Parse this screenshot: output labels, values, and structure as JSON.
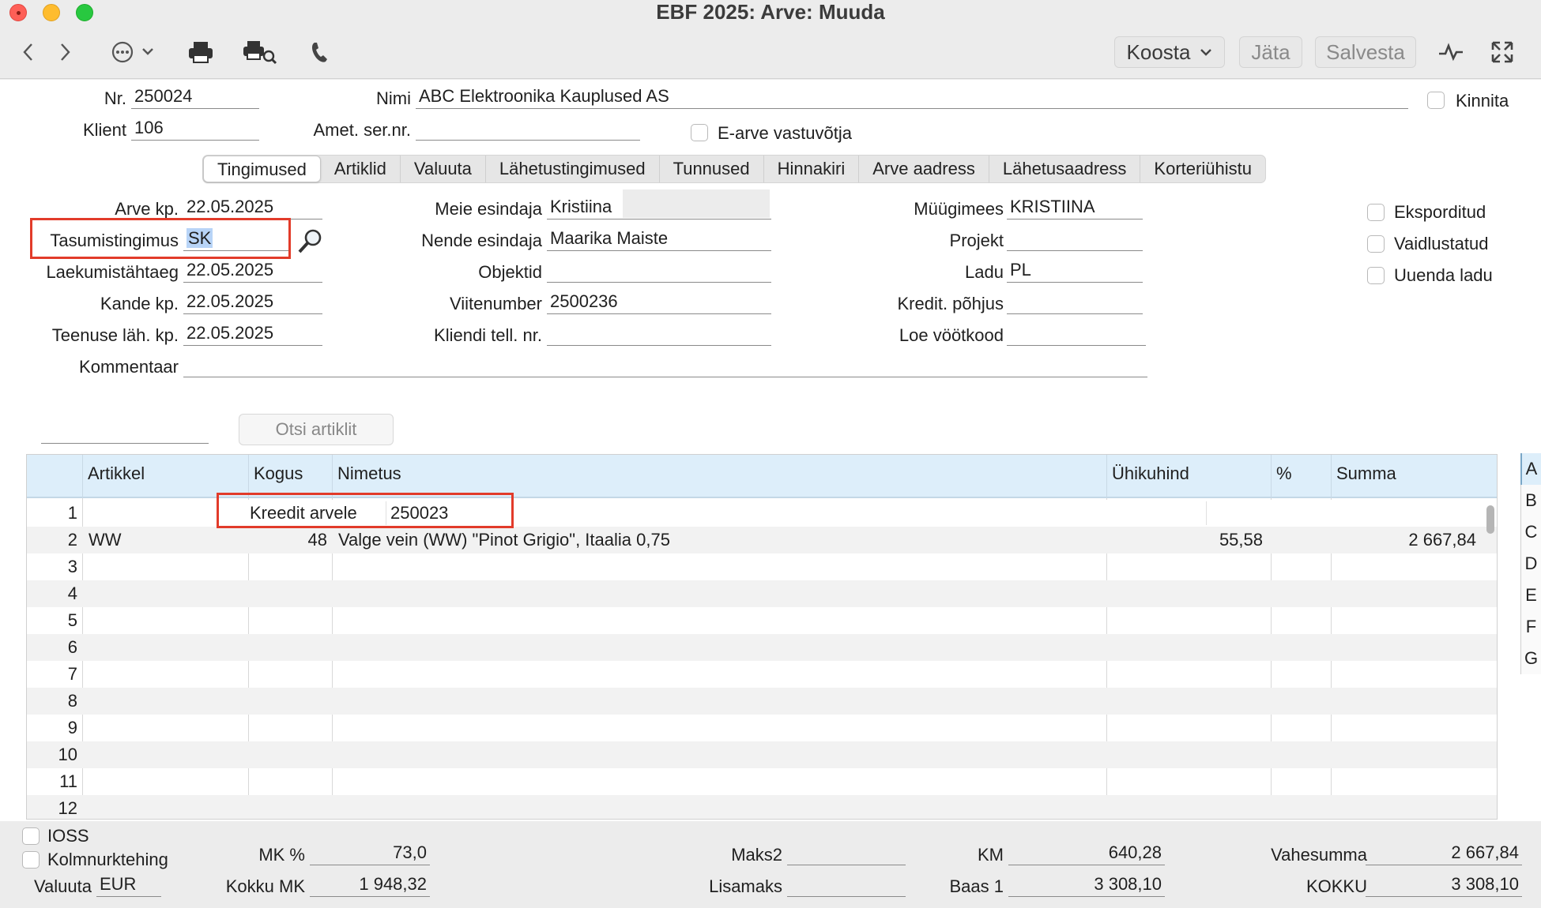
{
  "window": {
    "title": "EBF 2025: Arve: Muuda"
  },
  "toolbar": {
    "koosta_label": "Koosta",
    "jata_label": "Jäta",
    "salvesta_label": "Salvesta"
  },
  "header": {
    "nr_label": "Nr.",
    "nr_value": "250024",
    "nimi_label": "Nimi",
    "nimi_value": "ABC Elektroonika Kauplused AS",
    "kinnita_label": "Kinnita",
    "klient_label": "Klient",
    "klient_value": "106",
    "amet_label": "Amet. ser.nr.",
    "amet_value": "",
    "earve_label": "E-arve vastuvõtja"
  },
  "tabs": [
    {
      "label": "Tingimused"
    },
    {
      "label": "Artiklid"
    },
    {
      "label": "Valuuta"
    },
    {
      "label": "Lähetustingimused"
    },
    {
      "label": "Tunnused"
    },
    {
      "label": "Hinnakiri"
    },
    {
      "label": "Arve aadress"
    },
    {
      "label": "Lähetusaadress"
    },
    {
      "label": "Korteriühistu"
    }
  ],
  "terms": {
    "arve_kp_label": "Arve kp.",
    "arve_kp": "22.05.2025",
    "tasumis_label": "Tasumistingimus",
    "tasumis": "SK",
    "laekumis_label": "Laekumistähtaeg",
    "laekumis": "22.05.2025",
    "kande_label": "Kande kp.",
    "kande": "22.05.2025",
    "teenuse_label": "Teenuse läh. kp.",
    "teenuse": "22.05.2025",
    "kommentaar_label": "Kommentaar",
    "kommentaar": "",
    "meie_label": "Meie esindaja",
    "meie": "Kristiina",
    "nende_label": "Nende esindaja",
    "nende": "Maarika Maiste",
    "objektid_label": "Objektid",
    "objektid": "",
    "viite_label": "Viitenumber",
    "viite": "2500236",
    "kliendi_label": "Kliendi tell. nr.",
    "kliendi": "",
    "muugi_label": "Müügimees",
    "muugi": "KRISTIINA",
    "projekt_label": "Projekt",
    "projekt": "",
    "ladu_label": "Ladu",
    "ladu": "PL",
    "kredit_label": "Kredit. põhjus",
    "kredit": "",
    "loe_label": "Loe vöötkood",
    "loe": "",
    "eksport_label": "Eksporditud",
    "vaidl_label": "Vaidlustatud",
    "uuenda_label": "Uuenda ladu"
  },
  "search": {
    "button_label": "Otsi artiklit",
    "value": ""
  },
  "grid": {
    "headers": [
      "Artikkel",
      "Kogus",
      "Nimetus",
      "Ühikuhind",
      "%",
      "Summa"
    ],
    "row1": {
      "num": "1",
      "label": "Kreedit arvele",
      "value": "250023"
    },
    "row2": {
      "num": "2",
      "artikkel": "WW",
      "kogus": "48",
      "nimetus": "Valge vein (WW) \"Pinot Grigio\", Itaalia 0,75",
      "uhikuhind": "55,58",
      "summa": "2 667,84"
    },
    "empty_rows": [
      "3",
      "4",
      "5",
      "6",
      "7",
      "8",
      "9",
      "10",
      "11",
      "12"
    ],
    "letters": [
      "A",
      "B",
      "C",
      "D",
      "E",
      "F",
      "G"
    ]
  },
  "footer": {
    "ioss_label": "IOSS",
    "kolmnurk_label": "Kolmnurktehing",
    "valuuta_label": "Valuuta",
    "valuuta": "EUR",
    "mk_pct_label": "MK %",
    "mk_pct": "73,0",
    "kokku_mk_label": "Kokku MK",
    "kokku_mk": "1 948,32",
    "maks2_label": "Maks2",
    "maks2": "",
    "lisamaks_label": "Lisamaks",
    "lisamaks": "",
    "km_label": "KM",
    "km": "640,28",
    "baas1_label": "Baas 1",
    "baas1": "3 308,10",
    "vahesumma_label": "Vahesumma",
    "vahesumma": "2 667,84",
    "kokku_label": "KOKKU",
    "kokku": "3 308,10"
  }
}
